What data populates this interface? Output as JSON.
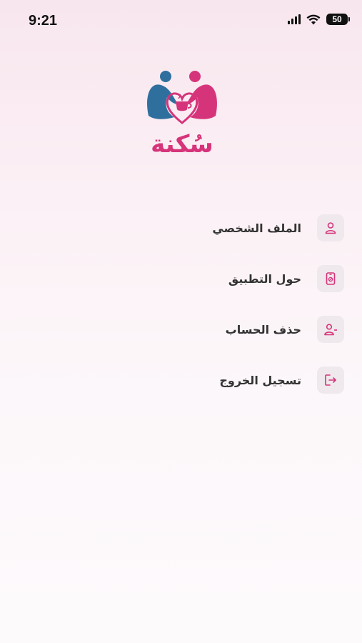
{
  "status_bar": {
    "time": "9:21",
    "battery": "50",
    "icons": [
      "signal-icon",
      "wifi-icon",
      "battery-icon"
    ]
  },
  "app": {
    "logo_text": "سُكنة",
    "logo_colors": {
      "blue": "#2f6f9e",
      "pink": "#d6347a"
    }
  },
  "menu": {
    "items": [
      {
        "label": "الملف الشخصي",
        "icon": "user-icon"
      },
      {
        "label": "حول التطبيق",
        "icon": "phone-info-icon"
      },
      {
        "label": "حذف الحساب",
        "icon": "user-minus-icon"
      },
      {
        "label": "تسجيل الخروج",
        "icon": "logout-icon"
      }
    ],
    "icon_color": "#d6347a",
    "icon_bg": "#efe8ec"
  }
}
